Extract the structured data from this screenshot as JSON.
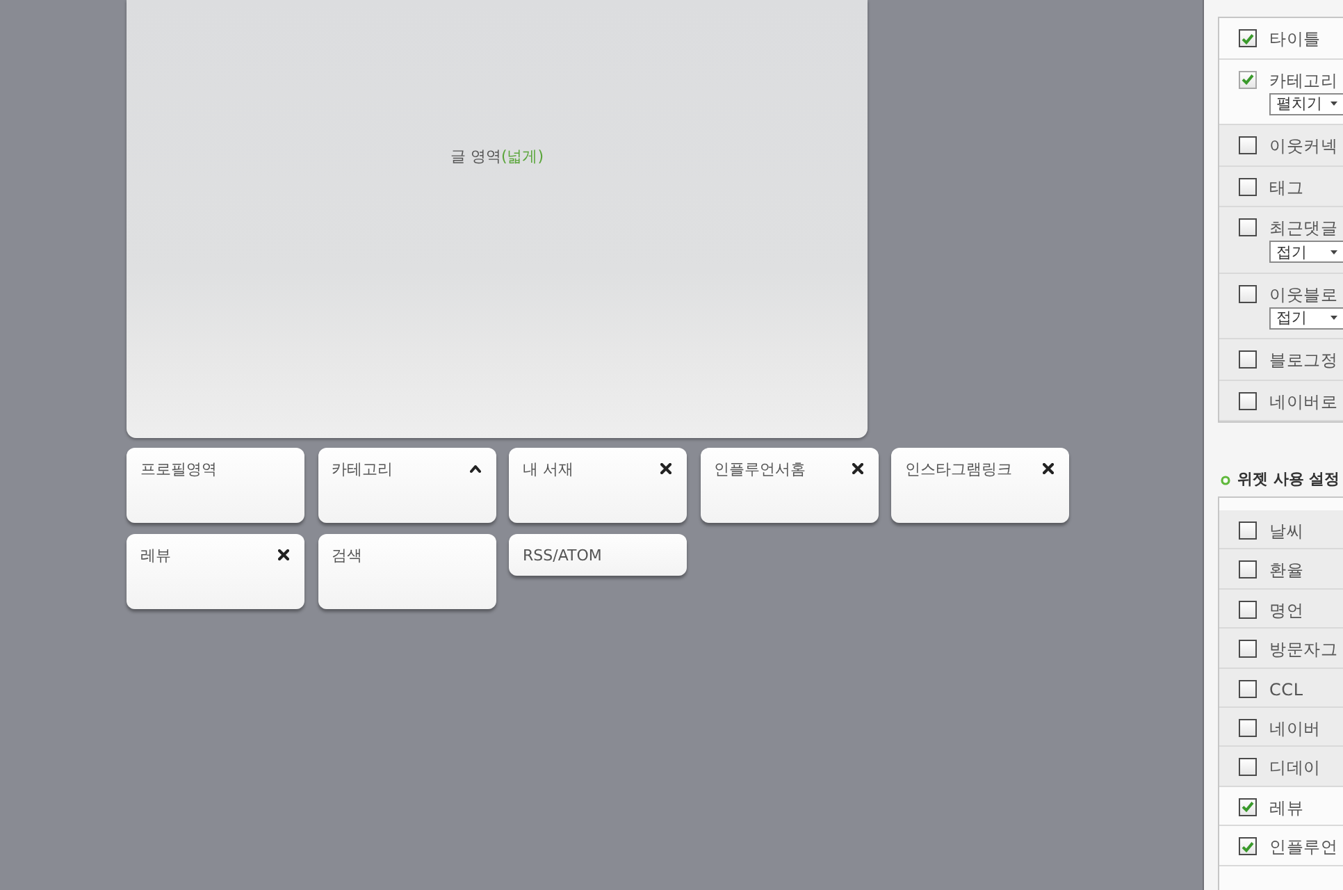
{
  "content_area": {
    "label": "글 영역",
    "note": "(넓게)"
  },
  "widget_blocks": [
    {
      "label": "프로필영역",
      "kind": "block",
      "collapsible": false,
      "removable": false
    },
    {
      "label": "카테고리",
      "kind": "block",
      "collapsible": true,
      "removable": false
    },
    {
      "label": "내 서재",
      "kind": "block",
      "collapsible": false,
      "removable": true
    },
    {
      "label": "인플루언서홈",
      "kind": "block",
      "collapsible": false,
      "removable": true
    },
    {
      "label": "인스타그램링크",
      "kind": "block",
      "collapsible": false,
      "removable": true
    },
    {
      "label": "레뷰",
      "kind": "block",
      "collapsible": false,
      "removable": true
    },
    {
      "label": "검색",
      "kind": "block",
      "collapsible": false,
      "removable": false
    },
    {
      "label": "RSS/ATOM",
      "kind": "line",
      "collapsible": false,
      "removable": false
    }
  ],
  "menu_settings": {
    "items": [
      {
        "label": "타이틀",
        "checked": true,
        "disabled": false
      },
      {
        "label": "카테고리",
        "checked": true,
        "disabled": true,
        "select": "펼치기"
      },
      {
        "label": "이웃커넥",
        "checked": false,
        "disabled": false
      },
      {
        "label": "태그",
        "checked": false,
        "disabled": false
      },
      {
        "label": "최근댓글",
        "checked": false,
        "disabled": false,
        "select": "접기"
      },
      {
        "label": "이웃블로",
        "checked": false,
        "disabled": false,
        "select": "접기"
      },
      {
        "label": "블로그정",
        "checked": false,
        "disabled": false
      },
      {
        "label": "네이버로",
        "checked": false,
        "disabled": false
      }
    ]
  },
  "widget_settings": {
    "title": "위젯 사용 설정",
    "items": [
      {
        "label": "날씨",
        "checked": false
      },
      {
        "label": "환율",
        "checked": false
      },
      {
        "label": "명언",
        "checked": false
      },
      {
        "label": "방문자그",
        "checked": false
      },
      {
        "label": "CCL",
        "checked": false
      },
      {
        "label": "네이버",
        "checked": false
      },
      {
        "label": "디데이",
        "checked": false
      },
      {
        "label": "레뷰",
        "checked": true
      },
      {
        "label": "인플루언",
        "checked": true
      }
    ]
  }
}
